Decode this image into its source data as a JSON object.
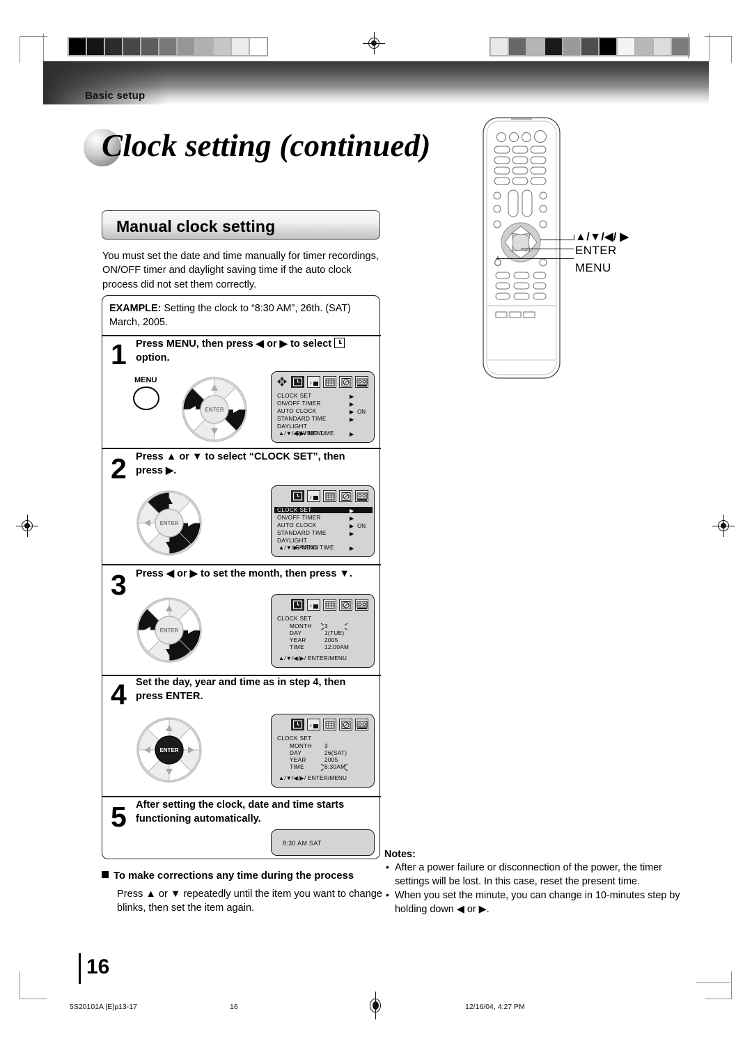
{
  "header": {
    "section_label": "Basic setup",
    "title": "Clock setting (continued)"
  },
  "section": {
    "heading": "Manual clock setting",
    "intro": "You must set the date and time manually for timer recordings, ON/OFF timer and daylight saving time if the auto clock process did not set them correctly.",
    "example_label": "EXAMPLE:",
    "example_text": "Setting the clock to “8:30 AM”, 26th. (SAT) March, 2005."
  },
  "steps": [
    {
      "num": "1",
      "text": "Press MENU, then press ◀ or ▶ to select  option."
    },
    {
      "num": "2",
      "text": "Press ▲ or ▼ to select “CLOCK SET”, then press ▶."
    },
    {
      "num": "3",
      "text": "Press ◀ or ▶ to set the month, then press ▼."
    },
    {
      "num": "4",
      "text": "Set the day, year and time as in step 4, then press ENTER."
    },
    {
      "num": "5",
      "text": "After setting the clock, date and time starts functioning automatically."
    }
  ],
  "step1": {
    "text_a": "Press MENU, then press ◀ or ▶ to select",
    "text_b": "option.",
    "menu_button_label": "MENU",
    "enter_label": "ENTER"
  },
  "step2": {
    "enter_label": "ENTER"
  },
  "step3": {
    "enter_label": "ENTER"
  },
  "step4": {
    "enter_label": "ENTER"
  },
  "osd_menu": {
    "rows": [
      {
        "label": "CLOCK SET",
        "value": "",
        "arrow": "▶",
        "highlight": false
      },
      {
        "label": "ON/OFF TIMER",
        "value": "",
        "arrow": "▶",
        "highlight": false
      },
      {
        "label": "AUTO CLOCK",
        "value": "ON",
        "arrow": "▶",
        "highlight": false
      },
      {
        "label": "STANDARD TIME",
        "value": "",
        "arrow": "▶",
        "highlight": false
      },
      {
        "label": "DAYLIGHT",
        "value": "",
        "arrow": "",
        "highlight": false
      },
      {
        "label": "SAVING TIME",
        "value": "",
        "arrow": "▶",
        "highlight": false
      }
    ],
    "footer_step1": "▲/▼/◀/▶/ MENU",
    "footer_step2": "▲/▼/▶/ MENU",
    "highlight_row_step2": "CLOCK SET"
  },
  "osd_clockset_step3": {
    "title": "CLOCK SET",
    "rows": [
      {
        "label": "MONTH",
        "value": "3",
        "blink": true
      },
      {
        "label": "DAY",
        "value": "1(TUE)",
        "blink": false
      },
      {
        "label": "YEAR",
        "value": "2005",
        "blink": false
      },
      {
        "label": "TIME",
        "value": "12:00AM",
        "blink": false
      }
    ],
    "footer": "▲/▼/◀/▶/ ENTER/MENU"
  },
  "osd_clockset_step4": {
    "title": "CLOCK SET",
    "rows": [
      {
        "label": "MONTH",
        "value": "3",
        "blink": false
      },
      {
        "label": "DAY",
        "value": "26(SAT)",
        "blink": false
      },
      {
        "label": "YEAR",
        "value": "2005",
        "blink": false
      },
      {
        "label": "TIME",
        "value": "8:30AM",
        "blink": true
      }
    ],
    "footer": "▲/▼/◀/▶/ ENTER/MENU"
  },
  "osd_clock_display": {
    "text": "8:30 AM  SAT"
  },
  "corrections": {
    "heading": "To make corrections any time during the process",
    "body": "Press ▲ or ▼ repeatedly until the item you want to change blinks, then set the item again."
  },
  "notes": {
    "title": "Notes:",
    "items": [
      "After a power failure or disconnection of the power, the timer settings will be lost. In this case, reset the present time.",
      "When you set the minute, you can change in 10-minutes step by holding down ◀ or ▶."
    ]
  },
  "remote_callouts": {
    "arrows": "▲/▼/◀/ ▶",
    "enter": "ENTER",
    "menu": "MENU"
  },
  "page": {
    "number": "16"
  },
  "footer": {
    "left": "5S20101A [E]p13-17",
    "center": "16",
    "right": "12/16/04, 4:27 PM"
  },
  "calibration": {
    "left_strip": [
      "#000000",
      "#141414",
      "#2b2b2b",
      "#474747",
      "#5e5e5e",
      "#787878",
      "#969696",
      "#b0b0b0",
      "#c6c6c6",
      "#ececec",
      "#ffffff"
    ],
    "right_strip": [
      "#e8e8e8",
      "#686868",
      "#b4b4b4",
      "#1a1a1a",
      "#9a9a9a",
      "#4e4e4e",
      "#000000",
      "#f4f4f4",
      "#b8b8b8",
      "#dcdcdc",
      "#7c7c7c"
    ]
  }
}
